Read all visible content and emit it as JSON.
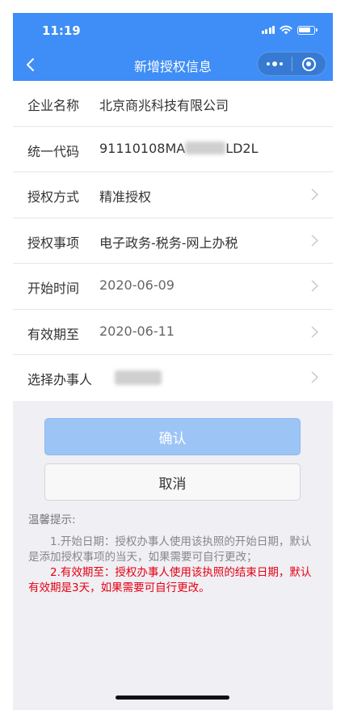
{
  "status_bar": {
    "time": "11:19"
  },
  "nav": {
    "title": "新增授权信息",
    "back_icon": "chevron-left-icon",
    "more_icon": "more-dots-icon",
    "close_icon": "target-circle-icon"
  },
  "form": {
    "rows": [
      {
        "label": "企业名称",
        "value": "北京商兆科技有限公司"
      },
      {
        "label": "统一代码",
        "value_prefix": "91110108MA",
        "value_suffix": "LD2L"
      },
      {
        "label": "授权方式",
        "value": "精准授权"
      },
      {
        "label": "授权事项",
        "value": "电子政务-税务-网上办税"
      },
      {
        "label": "开始时间",
        "value": "2020-06-09"
      },
      {
        "label": "有效期至",
        "value": "2020-06-11"
      },
      {
        "label": "选择办事人",
        "value": ""
      }
    ]
  },
  "buttons": {
    "confirm": "确认",
    "cancel": "取消"
  },
  "tips": {
    "title": "温馨提示:",
    "item1": "1.开始日期：授权办事人使用该执照的开始日期，默认是添加授权事项的当天，如果需要可自行更改；",
    "item2": "2.有效期至：授权办事人使用该执照的结束日期，默认有效期是3天，如果需要可自行更改。"
  },
  "colors": {
    "brand_blue": "#3f8ef7",
    "confirm_disabled": "#9cc5f6",
    "warning_red": "#e60012",
    "background": "#efeff4"
  }
}
